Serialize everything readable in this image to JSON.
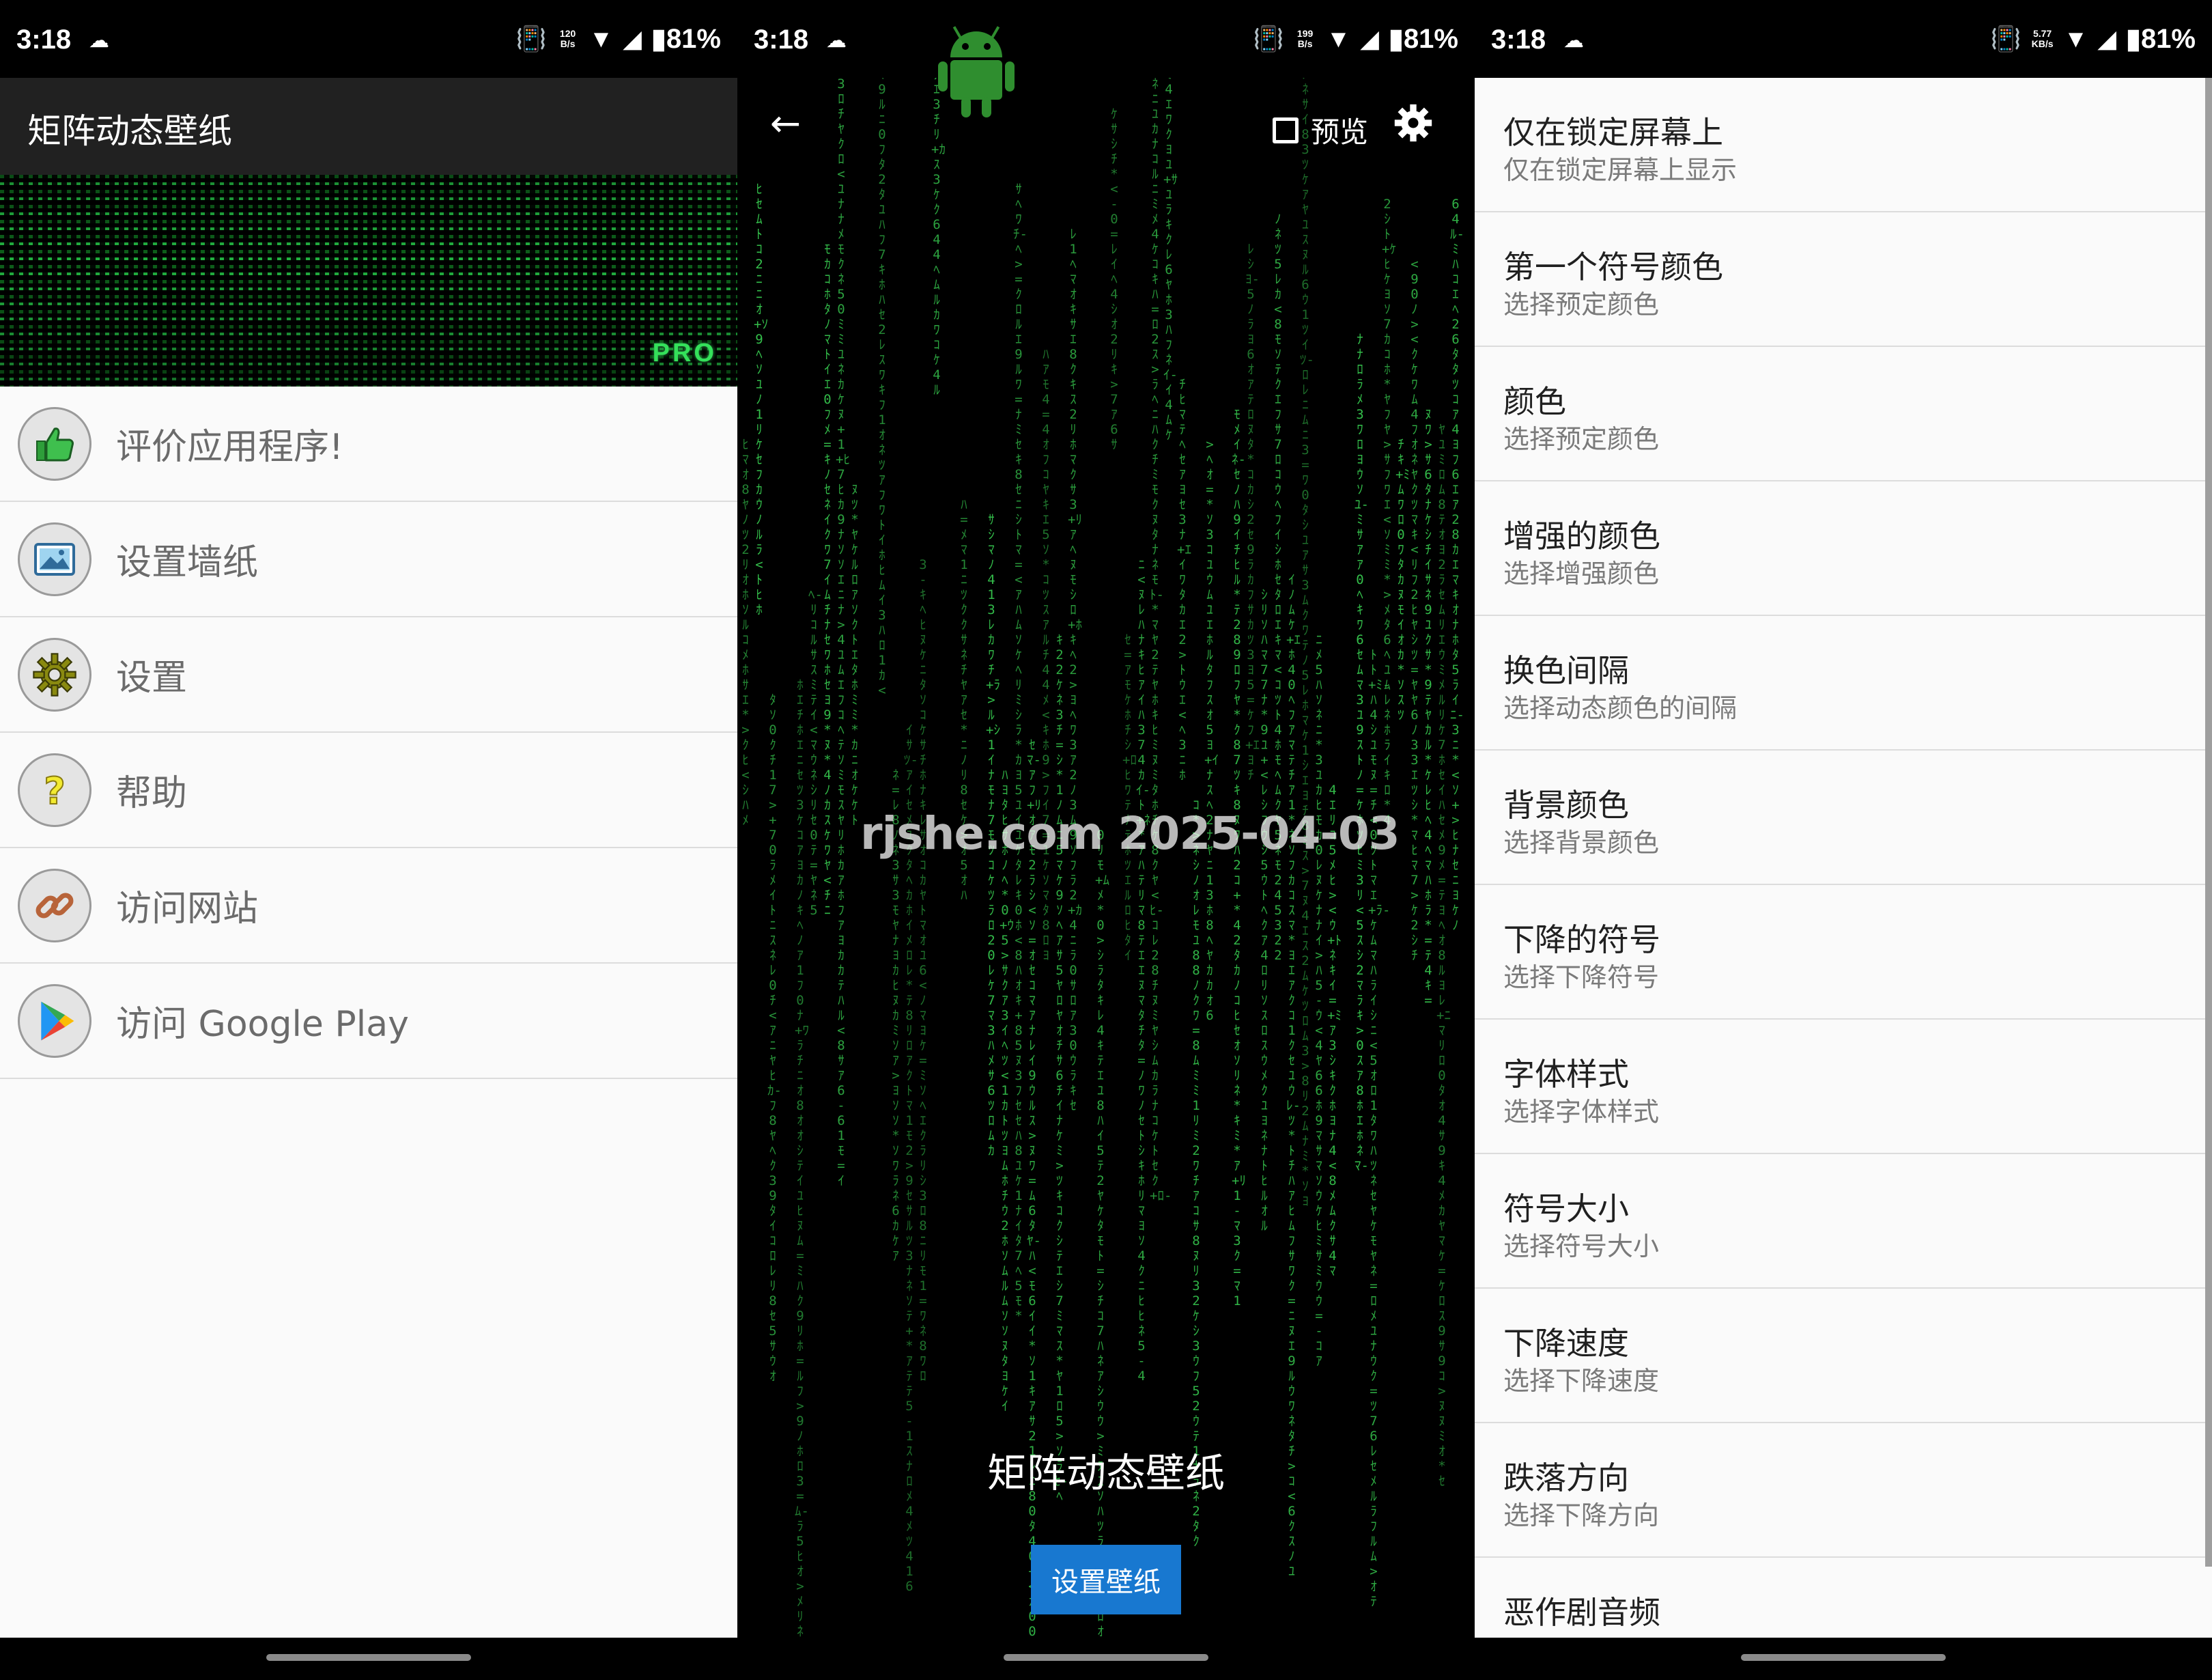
{
  "status_bars": [
    {
      "time": "3:18",
      "speed_value": "120",
      "speed_unit": "B/s",
      "battery": "81%"
    },
    {
      "time": "3:18",
      "speed_value": "199",
      "speed_unit": "B/s",
      "battery": "81%"
    },
    {
      "time": "3:18",
      "speed_value": "5.77",
      "speed_unit": "KB/s",
      "battery": "81%"
    }
  ],
  "main_screen": {
    "title": "矩阵动态壁纸",
    "banner_badge": "PRO",
    "menu": [
      {
        "label": "评价应用程序!",
        "icon": "thumbs-up-icon"
      },
      {
        "label": "设置墙纸",
        "icon": "image-icon"
      },
      {
        "label": "设置",
        "icon": "gear-icon"
      },
      {
        "label": "帮助",
        "icon": "question-icon"
      },
      {
        "label": "访问网站",
        "icon": "link-icon"
      },
      {
        "label": "访问 Google Play",
        "icon": "google-play-icon"
      }
    ]
  },
  "preview_screen": {
    "preview_label": "预览",
    "watermark": "rjshe.com 2025-04-03",
    "title": "矩阵动态壁纸",
    "set_button": "设置壁纸"
  },
  "settings_screen": {
    "items": [
      {
        "title": "仅在锁定屏幕上",
        "subtitle": "仅在锁定屏幕上显示"
      },
      {
        "title": "第一个符号颜色",
        "subtitle": "选择预定颜色"
      },
      {
        "title": "颜色",
        "subtitle": "选择预定颜色"
      },
      {
        "title": "增强的颜色",
        "subtitle": "选择增强颜色"
      },
      {
        "title": "换色间隔",
        "subtitle": "选择动态颜色的间隔"
      },
      {
        "title": "背景颜色",
        "subtitle": "选择背景颜色"
      },
      {
        "title": "下降的符号",
        "subtitle": "选择下降符号"
      },
      {
        "title": "字体样式",
        "subtitle": "选择字体样式"
      },
      {
        "title": "符号大小",
        "subtitle": "选择符号大小"
      },
      {
        "title": "下降速度",
        "subtitle": "选择下降速度"
      },
      {
        "title": "跌落方向",
        "subtitle": "选择下降方向"
      },
      {
        "title": "恶作剧音频",
        "subtitle": ""
      }
    ]
  },
  "colors": {
    "matrix_green": "#35c24c",
    "app_bar": "#212121",
    "button_blue": "#1878d0"
  }
}
